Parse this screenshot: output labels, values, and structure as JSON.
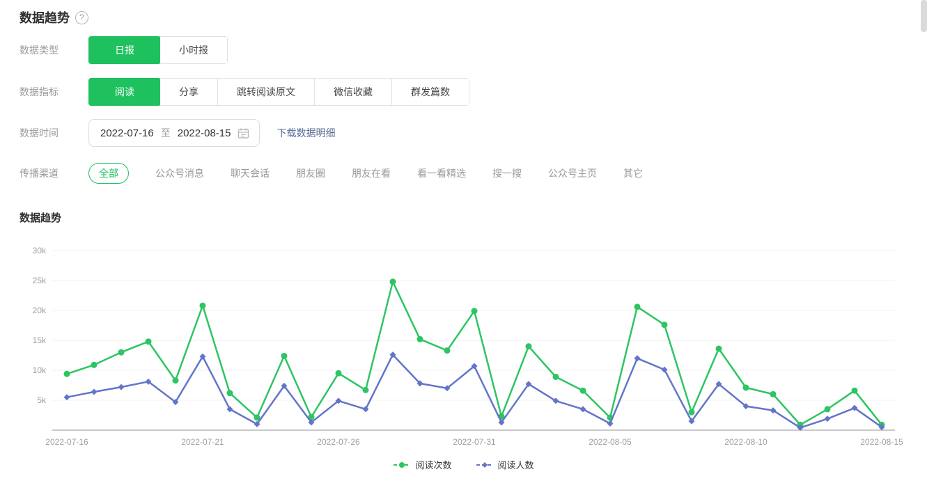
{
  "page": {
    "title": "数据趋势",
    "help_glyph": "?"
  },
  "colors": {
    "accent_green": "#1ec15e",
    "chart_green": "#2dc563",
    "chart_blue": "#6375c8",
    "link_blue": "#576b95",
    "label_grey": "#9a9a9a",
    "grid_line": "#f0f0f0",
    "axis_line": "#c9c9c9",
    "tick_text": "#9e9e9e"
  },
  "filters": {
    "data_type": {
      "label": "数据类型",
      "options": [
        {
          "label": "日报",
          "selected": true
        },
        {
          "label": "小时报",
          "selected": false
        }
      ]
    },
    "metric": {
      "label": "数据指标",
      "options": [
        {
          "label": "阅读",
          "selected": true
        },
        {
          "label": "分享",
          "selected": false
        },
        {
          "label": "跳转阅读原文",
          "selected": false
        },
        {
          "label": "微信收藏",
          "selected": false
        },
        {
          "label": "群发篇数",
          "selected": false
        }
      ]
    },
    "time": {
      "label": "数据时间",
      "start": "2022-07-16",
      "separator": "至",
      "end": "2022-08-15",
      "download_label": "下载数据明细"
    },
    "channel": {
      "label": "传播渠道",
      "options": [
        {
          "label": "全部",
          "selected": true
        },
        {
          "label": "公众号消息",
          "selected": false
        },
        {
          "label": "聊天会话",
          "selected": false
        },
        {
          "label": "朋友圈",
          "selected": false
        },
        {
          "label": "朋友在看",
          "selected": false
        },
        {
          "label": "看一看精选",
          "selected": false
        },
        {
          "label": "搜一搜",
          "selected": false
        },
        {
          "label": "公众号主页",
          "selected": false
        },
        {
          "label": "其它",
          "selected": false
        }
      ]
    }
  },
  "chart_section": {
    "title": "数据趋势"
  },
  "chart_data": {
    "type": "line",
    "title": "数据趋势",
    "x_dates": [
      "2022-07-16",
      "2022-07-17",
      "2022-07-18",
      "2022-07-19",
      "2022-07-20",
      "2022-07-21",
      "2022-07-22",
      "2022-07-23",
      "2022-07-24",
      "2022-07-25",
      "2022-07-26",
      "2022-07-27",
      "2022-07-28",
      "2022-07-29",
      "2022-07-30",
      "2022-07-31",
      "2022-08-01",
      "2022-08-02",
      "2022-08-03",
      "2022-08-04",
      "2022-08-05",
      "2022-08-06",
      "2022-08-07",
      "2022-08-08",
      "2022-08-09",
      "2022-08-10",
      "2022-08-11",
      "2022-08-12",
      "2022-08-13",
      "2022-08-14",
      "2022-08-15"
    ],
    "series": [
      {
        "name": "阅读次数",
        "marker": "circle",
        "color": "#2dc563",
        "values": [
          9400,
          10900,
          13000,
          14800,
          8300,
          20800,
          6200,
          2100,
          12400,
          2200,
          9500,
          6700,
          24800,
          15200,
          13300,
          19900,
          2300,
          14000,
          8900,
          6600,
          2100,
          20600,
          17600,
          3000,
          13600,
          7100,
          6000,
          900,
          3500,
          6600,
          900
        ]
      },
      {
        "name": "阅读人数",
        "marker": "diamond",
        "color": "#6375c8",
        "values": [
          5500,
          6400,
          7200,
          8100,
          4700,
          12300,
          3500,
          1000,
          7400,
          1300,
          4900,
          3500,
          12600,
          7800,
          7000,
          10700,
          1300,
          7700,
          4900,
          3500,
          1100,
          12000,
          10100,
          1500,
          7700,
          4000,
          3300,
          400,
          1900,
          3700,
          500
        ]
      }
    ],
    "ylim": [
      0,
      30000
    ],
    "yticks": [
      "5k",
      "10k",
      "15k",
      "20k",
      "25k",
      "30k"
    ],
    "xticks": [
      "2022-07-16",
      "2022-07-21",
      "2022-07-26",
      "2022-07-31",
      "2022-08-05",
      "2022-08-10",
      "2022-08-15"
    ],
    "xtick_day_indices": [
      0,
      5,
      10,
      15,
      20,
      25,
      30
    ],
    "grid": true,
    "legend_position": "bottom"
  }
}
